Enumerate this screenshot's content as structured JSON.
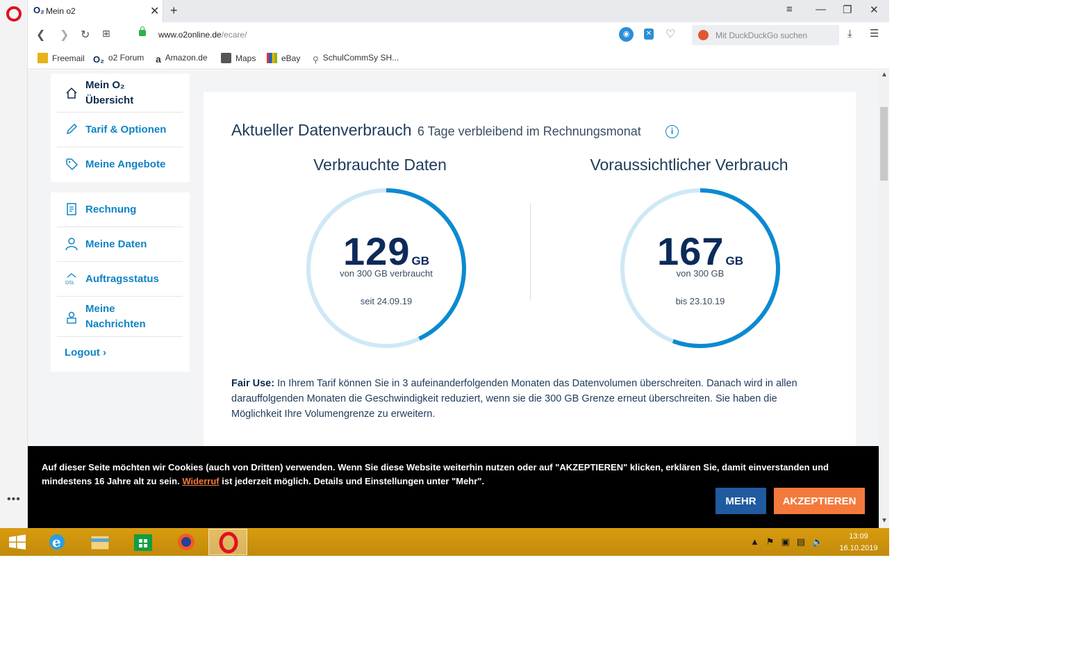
{
  "browser": {
    "tab_brand": "O₂",
    "tab_title": "Mein o2",
    "url_domain": "www.o2online.de",
    "url_path": "/ecare/",
    "search_placeholder": "Mit DuckDuckGo suchen"
  },
  "bookmarks": [
    {
      "label": "Freemail",
      "icon": "freemail-icon"
    },
    {
      "label": "o2 Forum",
      "icon": "o2-icon"
    },
    {
      "label": "Amazon.de",
      "icon": "amazon-icon"
    },
    {
      "label": "Maps",
      "icon": "maps-icon"
    },
    {
      "label": "eBay",
      "icon": "ebay-icon"
    },
    {
      "label": "SchulCommSy SH...",
      "icon": "schulcommsy-icon"
    }
  ],
  "sidebar": {
    "group1": [
      {
        "label_line1": "Mein O₂",
        "label_line2": "Übersicht",
        "icon": "home-icon"
      },
      {
        "label": "Tarif & Optionen",
        "icon": "pencil-icon"
      },
      {
        "label": "Meine Angebote",
        "icon": "tag-icon"
      }
    ],
    "group2": [
      {
        "label": "Rechnung",
        "icon": "invoice-icon"
      },
      {
        "label": "Meine Daten",
        "icon": "user-icon"
      },
      {
        "label": "Auftragsstatus",
        "icon": "dsl-icon"
      },
      {
        "label_line1": "Meine",
        "label_line2": "Nachrichten",
        "icon": "messages-icon"
      }
    ],
    "logout": "Logout ›"
  },
  "usage": {
    "heading": "Aktueller Datenverbrauch",
    "subheading": "6 Tage verbleibend im Rechnungsmonat",
    "used": {
      "title": "Verbrauchte Daten",
      "value": "129",
      "unit": "GB",
      "line1": "von 300 GB verbraucht",
      "line2": "seit 24.09.19",
      "fraction": 0.43
    },
    "forecast": {
      "title": "Voraussichtlicher Verbrauch",
      "value": "167",
      "unit": "GB",
      "line1": "von 300 GB",
      "line2": "bis 23.10.19",
      "fraction": 0.5567
    },
    "fair_use_label": "Fair Use:",
    "fair_use_text": " In Ihrem Tarif können Sie in 3 aufeinanderfolgenden Monaten das Datenvolumen überschreiten. Danach wird in allen darauffolgenden Monaten die Geschwindigkeit reduziert, wenn sie die 300 GB Grenze erneut überschreiten. Sie haben die Möglichkeit Ihre Volumengrenze zu erweitern."
  },
  "cookie": {
    "text_before": "Auf dieser Seite möchten wir Cookies (auch von Dritten) verwenden. Wenn Sie diese Website weiterhin nutzen oder auf \"AKZEPTIEREN\" klicken, erklären Sie, damit einverstanden und mindestens 16 Jahre alt zu sein. ",
    "link": "Widerruf",
    "text_after": " ist jederzeit möglich. Details und Einstellungen unter \"Mehr\".",
    "more_button": "MEHR",
    "accept_button": "AKZEPTIEREN"
  },
  "taskbar": {
    "time": "13:09",
    "date": "16.10.2019"
  },
  "colors": {
    "accent": "#0f83c6",
    "gauge_track": "#cfe8f6",
    "gauge_fill": "#0b8ad0",
    "cookie_accept": "#f37a3c",
    "cookie_more": "#1f5b9e",
    "taskbar": "#d99c0f"
  }
}
